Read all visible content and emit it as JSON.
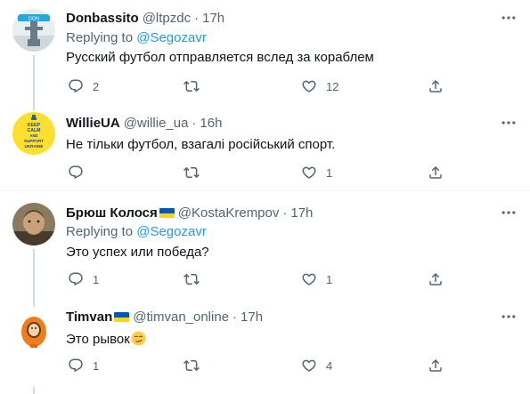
{
  "tweets": [
    {
      "name": "Donbassito",
      "handle": "@ltpzdc",
      "time": "17h",
      "replying_prefix": "Replying to ",
      "replying_to": "@Segozavr",
      "text": "Русский футбол отправляется вслед за кораблем",
      "replies": "2",
      "retweets": "",
      "likes": "12",
      "avatar_text": "DON"
    },
    {
      "name": "WillieUA",
      "handle": "@willie_ua",
      "time": "16h",
      "text": "Не тільки футбол, взагалі російський спорт.",
      "replies": "",
      "retweets": "",
      "likes": "1",
      "avatar_text": [
        "KEEP",
        "CALM",
        "AND",
        "SUPPORT",
        "UKRAINE"
      ]
    },
    {
      "name": "Брюш Колося",
      "handle": "@KostaKrempov",
      "time": "17h",
      "replying_prefix": "Replying to ",
      "replying_to": "@Segozavr",
      "text": "Это успех или победа?",
      "replies": "1",
      "retweets": "",
      "likes": "1"
    },
    {
      "name": "Timvan",
      "handle": "@timvan_online",
      "time": "17h",
      "text": "Это рывок",
      "replies": "1",
      "retweets": "",
      "likes": "4"
    }
  ],
  "colors": {
    "text": "#0f1419",
    "secondary": "#536471",
    "link": "#1d9bf0",
    "line": "#cfd9de",
    "separator": "#eff3f4",
    "flag_blue": "#0057b7",
    "flag_yellow": "#ffd700"
  },
  "icons": [
    "more-icon",
    "reply-icon",
    "retweet-icon",
    "like-icon",
    "share-icon",
    "flag-ukraine-icon",
    "smirk-emoji-icon"
  ]
}
